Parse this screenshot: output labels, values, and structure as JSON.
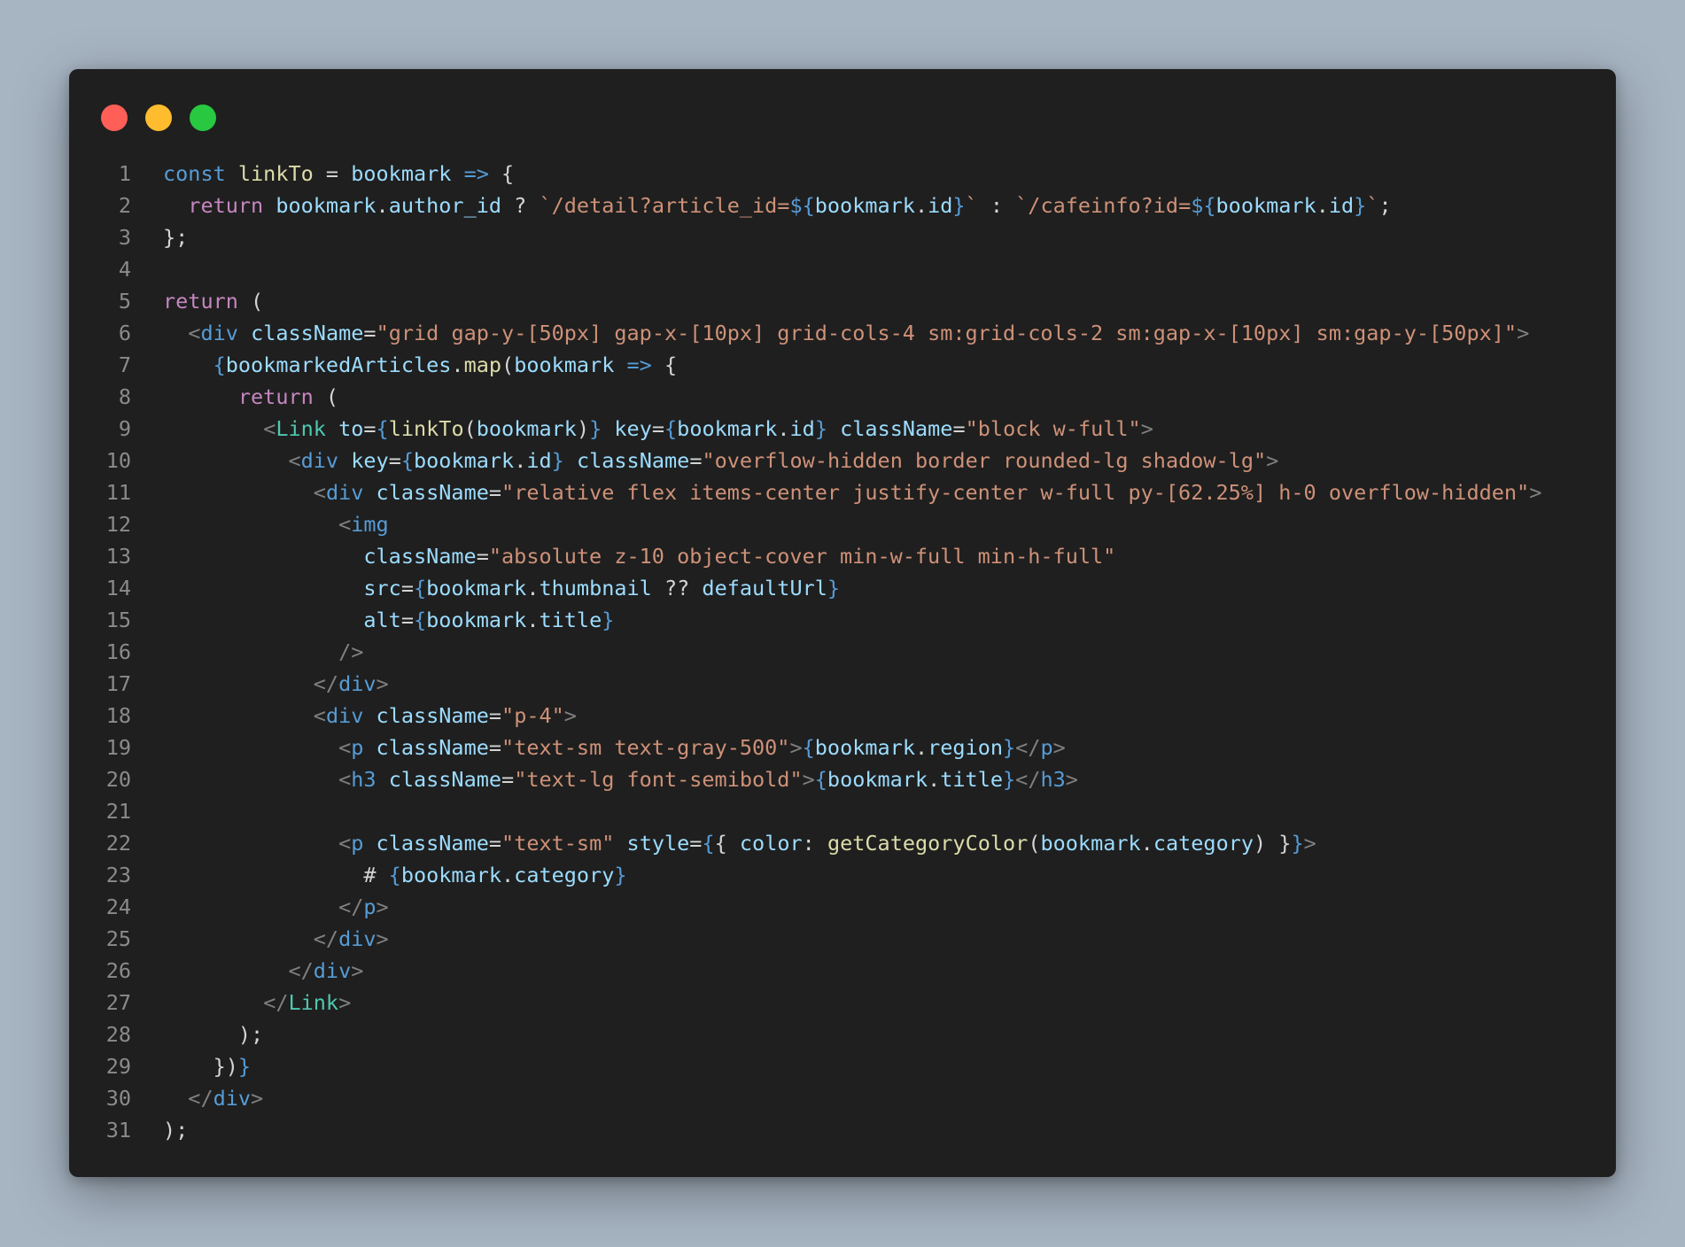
{
  "window": {
    "controls": [
      "close",
      "minimize",
      "maximize"
    ],
    "colors": {
      "close": "#ff5f57",
      "minimize": "#febc2e",
      "maximize": "#28c840",
      "background": "#1f1f1f"
    }
  },
  "theme": {
    "kw": "#569cd6",
    "ctl": "#c586c0",
    "var": "#9cdcfe",
    "fn": "#dcdcaa",
    "str": "#ce9178",
    "tag": "#569cd6",
    "comp": "#4ec9b0",
    "punc": "#808080",
    "brace": "#569cd6",
    "plain": "#d4d4d4"
  },
  "code": {
    "lines": [
      {
        "n": "1",
        "tokens": [
          [
            "kw",
            "const "
          ],
          [
            "fn",
            "linkTo"
          ],
          [
            "plain",
            " = "
          ],
          [
            "var",
            "bookmark"
          ],
          [
            "plain",
            " "
          ],
          [
            "kw",
            "=>"
          ],
          [
            "plain",
            " {"
          ]
        ]
      },
      {
        "n": "2",
        "tokens": [
          [
            "plain",
            "  "
          ],
          [
            "ctl",
            "return "
          ],
          [
            "var",
            "bookmark"
          ],
          [
            "plain",
            "."
          ],
          [
            "var",
            "author_id"
          ],
          [
            "plain",
            " ? "
          ],
          [
            "str",
            "`/detail?article_id="
          ],
          [
            "brace",
            "${"
          ],
          [
            "var",
            "bookmark"
          ],
          [
            "plain",
            "."
          ],
          [
            "var",
            "id"
          ],
          [
            "brace",
            "}"
          ],
          [
            "str",
            "`"
          ],
          [
            "plain",
            " : "
          ],
          [
            "str",
            "`/cafeinfo?id="
          ],
          [
            "brace",
            "${"
          ],
          [
            "var",
            "bookmark"
          ],
          [
            "plain",
            "."
          ],
          [
            "var",
            "id"
          ],
          [
            "brace",
            "}"
          ],
          [
            "str",
            "`"
          ],
          [
            "plain",
            ";"
          ]
        ]
      },
      {
        "n": "3",
        "tokens": [
          [
            "plain",
            "};"
          ]
        ]
      },
      {
        "n": "4",
        "tokens": []
      },
      {
        "n": "5",
        "tokens": [
          [
            "ctl",
            "return"
          ],
          [
            "plain",
            " ("
          ]
        ]
      },
      {
        "n": "6",
        "tokens": [
          [
            "plain",
            "  "
          ],
          [
            "punc",
            "<"
          ],
          [
            "tag",
            "div"
          ],
          [
            "plain",
            " "
          ],
          [
            "var",
            "className"
          ],
          [
            "plain",
            "="
          ],
          [
            "str",
            "\"grid gap-y-[50px] gap-x-[10px] grid-cols-4 sm:grid-cols-2 sm:gap-x-[10px] sm:gap-y-[50px]\""
          ],
          [
            "punc",
            ">"
          ]
        ]
      },
      {
        "n": "7",
        "tokens": [
          [
            "plain",
            "    "
          ],
          [
            "brace",
            "{"
          ],
          [
            "var",
            "bookmarkedArticles"
          ],
          [
            "plain",
            "."
          ],
          [
            "fn",
            "map"
          ],
          [
            "plain",
            "("
          ],
          [
            "var",
            "bookmark"
          ],
          [
            "plain",
            " "
          ],
          [
            "kw",
            "=>"
          ],
          [
            "plain",
            " {"
          ]
        ]
      },
      {
        "n": "8",
        "tokens": [
          [
            "plain",
            "      "
          ],
          [
            "ctl",
            "return"
          ],
          [
            "plain",
            " ("
          ]
        ]
      },
      {
        "n": "9",
        "tokens": [
          [
            "plain",
            "        "
          ],
          [
            "punc",
            "<"
          ],
          [
            "comp",
            "Link"
          ],
          [
            "plain",
            " "
          ],
          [
            "var",
            "to"
          ],
          [
            "plain",
            "="
          ],
          [
            "brace",
            "{"
          ],
          [
            "fn",
            "linkTo"
          ],
          [
            "plain",
            "("
          ],
          [
            "var",
            "bookmark"
          ],
          [
            "plain",
            ")"
          ],
          [
            "brace",
            "}"
          ],
          [
            "plain",
            " "
          ],
          [
            "var",
            "key"
          ],
          [
            "plain",
            "="
          ],
          [
            "brace",
            "{"
          ],
          [
            "var",
            "bookmark"
          ],
          [
            "plain",
            "."
          ],
          [
            "var",
            "id"
          ],
          [
            "brace",
            "}"
          ],
          [
            "plain",
            " "
          ],
          [
            "var",
            "className"
          ],
          [
            "plain",
            "="
          ],
          [
            "str",
            "\"block w-full\""
          ],
          [
            "punc",
            ">"
          ]
        ]
      },
      {
        "n": "10",
        "tokens": [
          [
            "plain",
            "          "
          ],
          [
            "punc",
            "<"
          ],
          [
            "tag",
            "div"
          ],
          [
            "plain",
            " "
          ],
          [
            "var",
            "key"
          ],
          [
            "plain",
            "="
          ],
          [
            "brace",
            "{"
          ],
          [
            "var",
            "bookmark"
          ],
          [
            "plain",
            "."
          ],
          [
            "var",
            "id"
          ],
          [
            "brace",
            "}"
          ],
          [
            "plain",
            " "
          ],
          [
            "var",
            "className"
          ],
          [
            "plain",
            "="
          ],
          [
            "str",
            "\"overflow-hidden border rounded-lg shadow-lg\""
          ],
          [
            "punc",
            ">"
          ]
        ]
      },
      {
        "n": "11",
        "tokens": [
          [
            "plain",
            "            "
          ],
          [
            "punc",
            "<"
          ],
          [
            "tag",
            "div"
          ],
          [
            "plain",
            " "
          ],
          [
            "var",
            "className"
          ],
          [
            "plain",
            "="
          ],
          [
            "str",
            "\"relative flex items-center justify-center w-full py-[62.25%] h-0 overflow-hidden\""
          ],
          [
            "punc",
            ">"
          ]
        ]
      },
      {
        "n": "12",
        "tokens": [
          [
            "plain",
            "              "
          ],
          [
            "punc",
            "<"
          ],
          [
            "tag",
            "img"
          ]
        ]
      },
      {
        "n": "13",
        "tokens": [
          [
            "plain",
            "                "
          ],
          [
            "var",
            "className"
          ],
          [
            "plain",
            "="
          ],
          [
            "str",
            "\"absolute z-10 object-cover min-w-full min-h-full\""
          ]
        ]
      },
      {
        "n": "14",
        "tokens": [
          [
            "plain",
            "                "
          ],
          [
            "var",
            "src"
          ],
          [
            "plain",
            "="
          ],
          [
            "brace",
            "{"
          ],
          [
            "var",
            "bookmark"
          ],
          [
            "plain",
            "."
          ],
          [
            "var",
            "thumbnail"
          ],
          [
            "plain",
            " ?? "
          ],
          [
            "var",
            "defaultUrl"
          ],
          [
            "brace",
            "}"
          ]
        ]
      },
      {
        "n": "15",
        "tokens": [
          [
            "plain",
            "                "
          ],
          [
            "var",
            "alt"
          ],
          [
            "plain",
            "="
          ],
          [
            "brace",
            "{"
          ],
          [
            "var",
            "bookmark"
          ],
          [
            "plain",
            "."
          ],
          [
            "var",
            "title"
          ],
          [
            "brace",
            "}"
          ]
        ]
      },
      {
        "n": "16",
        "tokens": [
          [
            "plain",
            "              "
          ],
          [
            "punc",
            "/>"
          ]
        ]
      },
      {
        "n": "17",
        "tokens": [
          [
            "plain",
            "            "
          ],
          [
            "punc",
            "</"
          ],
          [
            "tag",
            "div"
          ],
          [
            "punc",
            ">"
          ]
        ]
      },
      {
        "n": "18",
        "tokens": [
          [
            "plain",
            "            "
          ],
          [
            "punc",
            "<"
          ],
          [
            "tag",
            "div"
          ],
          [
            "plain",
            " "
          ],
          [
            "var",
            "className"
          ],
          [
            "plain",
            "="
          ],
          [
            "str",
            "\"p-4\""
          ],
          [
            "punc",
            ">"
          ]
        ]
      },
      {
        "n": "19",
        "tokens": [
          [
            "plain",
            "              "
          ],
          [
            "punc",
            "<"
          ],
          [
            "tag",
            "p"
          ],
          [
            "plain",
            " "
          ],
          [
            "var",
            "className"
          ],
          [
            "plain",
            "="
          ],
          [
            "str",
            "\"text-sm text-gray-500\""
          ],
          [
            "punc",
            ">"
          ],
          [
            "brace",
            "{"
          ],
          [
            "var",
            "bookmark"
          ],
          [
            "plain",
            "."
          ],
          [
            "var",
            "region"
          ],
          [
            "brace",
            "}"
          ],
          [
            "punc",
            "</"
          ],
          [
            "tag",
            "p"
          ],
          [
            "punc",
            ">"
          ]
        ]
      },
      {
        "n": "20",
        "tokens": [
          [
            "plain",
            "              "
          ],
          [
            "punc",
            "<"
          ],
          [
            "tag",
            "h3"
          ],
          [
            "plain",
            " "
          ],
          [
            "var",
            "className"
          ],
          [
            "plain",
            "="
          ],
          [
            "str",
            "\"text-lg font-semibold\""
          ],
          [
            "punc",
            ">"
          ],
          [
            "brace",
            "{"
          ],
          [
            "var",
            "bookmark"
          ],
          [
            "plain",
            "."
          ],
          [
            "var",
            "title"
          ],
          [
            "brace",
            "}"
          ],
          [
            "punc",
            "</"
          ],
          [
            "tag",
            "h3"
          ],
          [
            "punc",
            ">"
          ]
        ]
      },
      {
        "n": "21",
        "tokens": []
      },
      {
        "n": "22",
        "tokens": [
          [
            "plain",
            "              "
          ],
          [
            "punc",
            "<"
          ],
          [
            "tag",
            "p"
          ],
          [
            "plain",
            " "
          ],
          [
            "var",
            "className"
          ],
          [
            "plain",
            "="
          ],
          [
            "str",
            "\"text-sm\""
          ],
          [
            "plain",
            " "
          ],
          [
            "var",
            "style"
          ],
          [
            "plain",
            "="
          ],
          [
            "brace",
            "{"
          ],
          [
            "plain",
            "{ "
          ],
          [
            "var",
            "color"
          ],
          [
            "plain",
            ": "
          ],
          [
            "fn",
            "getCategoryColor"
          ],
          [
            "plain",
            "("
          ],
          [
            "var",
            "bookmark"
          ],
          [
            "plain",
            "."
          ],
          [
            "var",
            "category"
          ],
          [
            "plain",
            ") }"
          ],
          [
            "brace",
            "}"
          ],
          [
            "punc",
            ">"
          ]
        ]
      },
      {
        "n": "23",
        "tokens": [
          [
            "plain",
            "                # "
          ],
          [
            "brace",
            "{"
          ],
          [
            "var",
            "bookmark"
          ],
          [
            "plain",
            "."
          ],
          [
            "var",
            "category"
          ],
          [
            "brace",
            "}"
          ]
        ]
      },
      {
        "n": "24",
        "tokens": [
          [
            "plain",
            "              "
          ],
          [
            "punc",
            "</"
          ],
          [
            "tag",
            "p"
          ],
          [
            "punc",
            ">"
          ]
        ]
      },
      {
        "n": "25",
        "tokens": [
          [
            "plain",
            "            "
          ],
          [
            "punc",
            "</"
          ],
          [
            "tag",
            "div"
          ],
          [
            "punc",
            ">"
          ]
        ]
      },
      {
        "n": "26",
        "tokens": [
          [
            "plain",
            "          "
          ],
          [
            "punc",
            "</"
          ],
          [
            "tag",
            "div"
          ],
          [
            "punc",
            ">"
          ]
        ]
      },
      {
        "n": "27",
        "tokens": [
          [
            "plain",
            "        "
          ],
          [
            "punc",
            "</"
          ],
          [
            "comp",
            "Link"
          ],
          [
            "punc",
            ">"
          ]
        ]
      },
      {
        "n": "28",
        "tokens": [
          [
            "plain",
            "      );"
          ]
        ]
      },
      {
        "n": "29",
        "tokens": [
          [
            "plain",
            "    })"
          ],
          [
            "brace",
            "}"
          ]
        ]
      },
      {
        "n": "30",
        "tokens": [
          [
            "plain",
            "  "
          ],
          [
            "punc",
            "</"
          ],
          [
            "tag",
            "div"
          ],
          [
            "punc",
            ">"
          ]
        ]
      },
      {
        "n": "31",
        "tokens": [
          [
            "plain",
            ");"
          ]
        ]
      }
    ]
  }
}
